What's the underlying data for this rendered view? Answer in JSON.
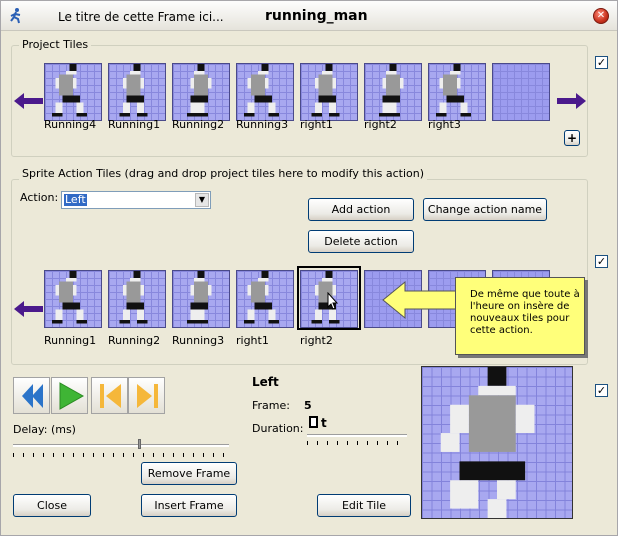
{
  "window": {
    "subtitle": "Le titre de cette Frame ici...",
    "title": "running_man",
    "close_glyph": "✕"
  },
  "project_tiles": {
    "group_label": "Project Tiles",
    "tiles": [
      {
        "label": "Running4"
      },
      {
        "label": "Running1"
      },
      {
        "label": "Running2"
      },
      {
        "label": "Running3"
      },
      {
        "label": "right1"
      },
      {
        "label": "right2"
      },
      {
        "label": "right3"
      },
      {
        "label": ""
      }
    ],
    "add_button": "+",
    "checkbox_checked": true,
    "checkbox_glyph": "✓"
  },
  "sprite_action": {
    "group_label": "Sprite Action Tiles (drag and drop project tiles here to modify this action)",
    "action_label": "Action:",
    "action_value": "Left",
    "combo_arrow": "▼",
    "buttons": {
      "add_action": "Add action",
      "change_action_name": "Change action name",
      "delete_action": "Delete action"
    },
    "tiles": [
      {
        "label": "Running1"
      },
      {
        "label": "Running2"
      },
      {
        "label": "Running3"
      },
      {
        "label": "right1"
      },
      {
        "label": "right2"
      }
    ],
    "checkbox_checked": true,
    "checkbox_glyph": "✓",
    "selected_index": 4
  },
  "tooltip": {
    "text": "De même que toute à l'heure on insère de nouveaux tiles pour cette action."
  },
  "playback": {
    "delay_label": "Delay: (ms)",
    "action_name": "Left",
    "frame_label": "Frame:",
    "frame_value": "5",
    "duration_label": "Duration:",
    "duration_value": "t",
    "checkbox_checked": true,
    "checkbox_glyph": "✓"
  },
  "footer_buttons": {
    "remove_frame": "Remove Frame",
    "close": "Close",
    "insert_frame": "Insert Frame",
    "edit_tile": "Edit Tile"
  },
  "colors": {
    "tile_bg": "#a8a8f0",
    "arrow": "#4b1a8c",
    "tooltip_bg": "#ffff7a",
    "play_green": "#3fb535",
    "rewind_blue": "#2b74c9",
    "skip_orange": "#f5b73a"
  }
}
